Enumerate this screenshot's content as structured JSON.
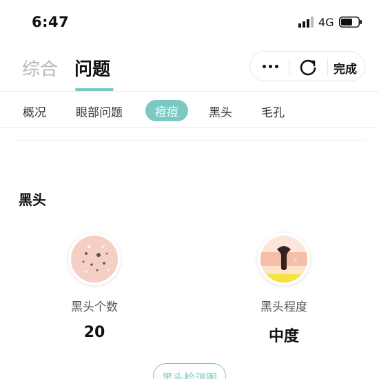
{
  "status_bar": {
    "time": "6:47",
    "network": "4G"
  },
  "header": {
    "tabs": [
      {
        "label": "综合",
        "active": false
      },
      {
        "label": "问题",
        "active": true
      }
    ],
    "capsule": {
      "more_icon": "ellipsis-icon",
      "refresh_icon": "refresh-icon",
      "done_label": "完成"
    }
  },
  "categories": [
    {
      "label": "概况",
      "selected": false
    },
    {
      "label": "眼部问题",
      "selected": false
    },
    {
      "label": "痘痘",
      "selected": true
    },
    {
      "label": "黑头",
      "selected": false
    },
    {
      "label": "毛孔",
      "selected": false
    }
  ],
  "section": {
    "title": "黑头",
    "metrics": [
      {
        "label": "黑头个数",
        "value": "20",
        "icon": "skin-dots-icon"
      },
      {
        "label": "黑头程度",
        "value": "中度",
        "icon": "pore-severity-icon"
      }
    ],
    "map_button_label": "黑头检测图"
  },
  "colors": {
    "accent": "#7cc8c4",
    "inactive_text": "#b8b8b8"
  }
}
